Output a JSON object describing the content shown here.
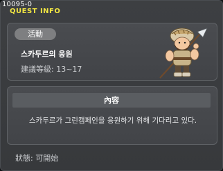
{
  "ref_id": "10095-0",
  "window": {
    "title": "QUEST INFO"
  },
  "quest": {
    "badge": "活動",
    "name": "스카두르의 응원",
    "level": "建議等級: 13~17",
    "npc_icon": "viking-warrior-npc-icon"
  },
  "content": {
    "header": "內容",
    "text": "스카두르가 그린캠페인을 응원하기 위해 기다리고 있다."
  },
  "status": "狀態: 可開始",
  "colors": {
    "title": "#f2e642",
    "panel": "#444649",
    "badge": "#7e7f81",
    "header": "#5a5d61"
  }
}
